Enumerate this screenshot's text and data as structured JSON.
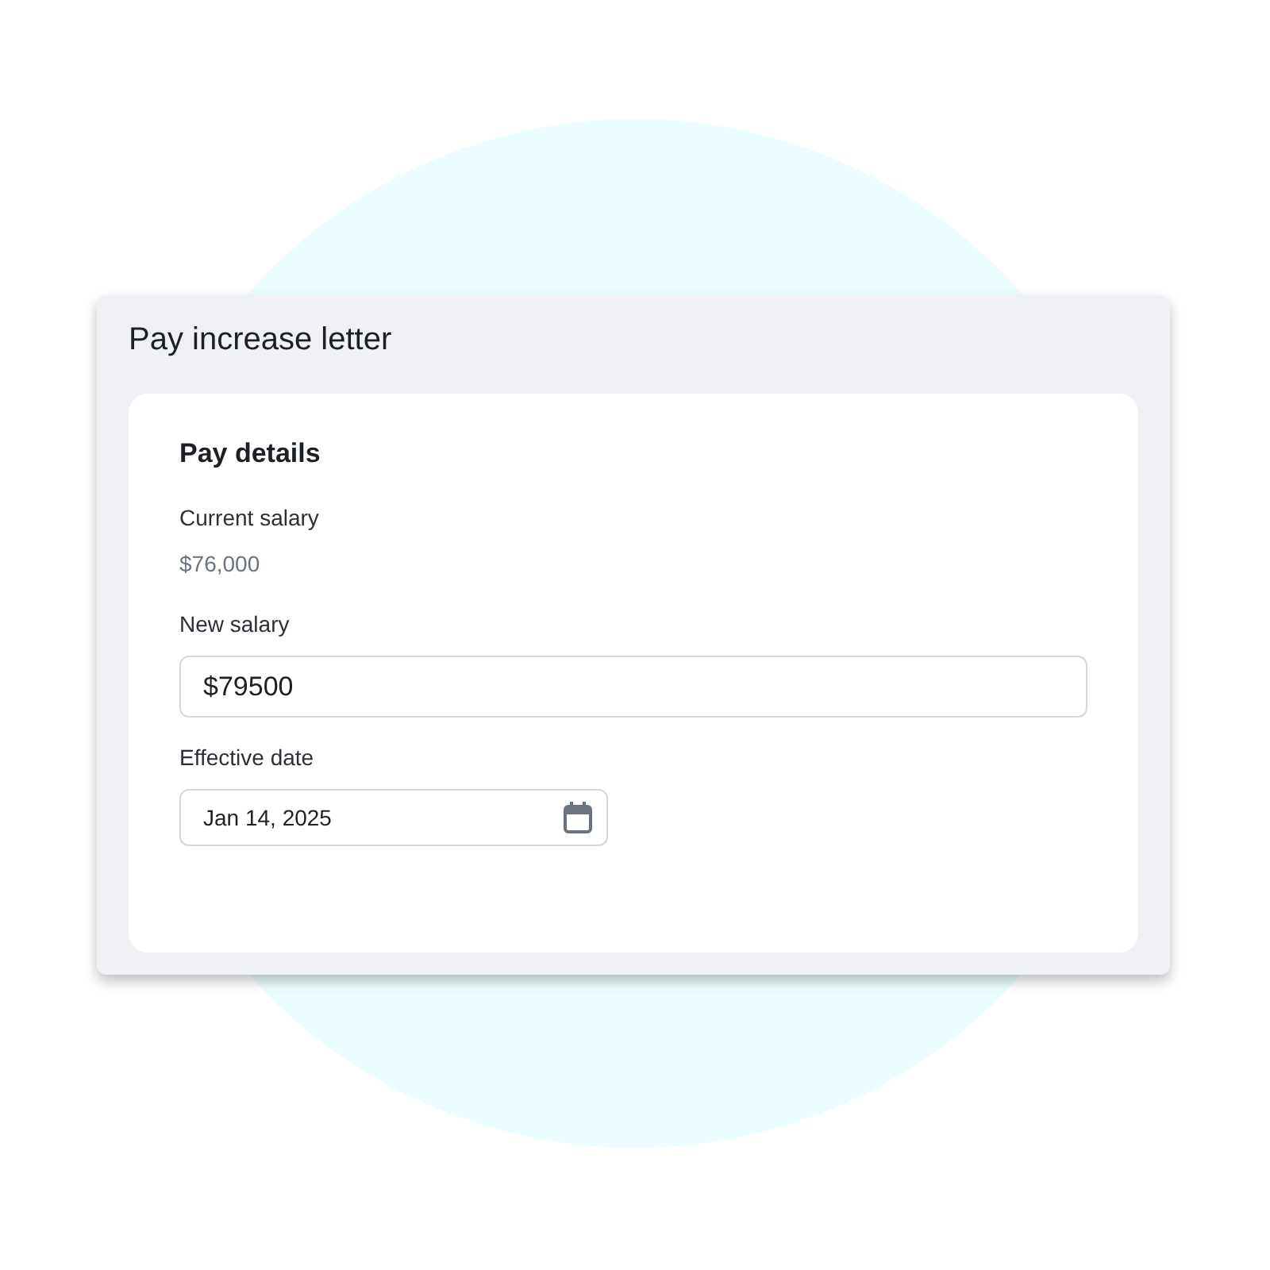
{
  "panel": {
    "title": "Pay increase letter"
  },
  "card": {
    "title": "Pay details",
    "fields": [
      {
        "kind": "readonly",
        "label": "Current salary",
        "value": "$76,000"
      },
      {
        "kind": "input",
        "label": "New salary",
        "value": "$79500"
      },
      {
        "kind": "date",
        "label": "Effective date",
        "value": "Jan 14, 2025"
      }
    ]
  }
}
